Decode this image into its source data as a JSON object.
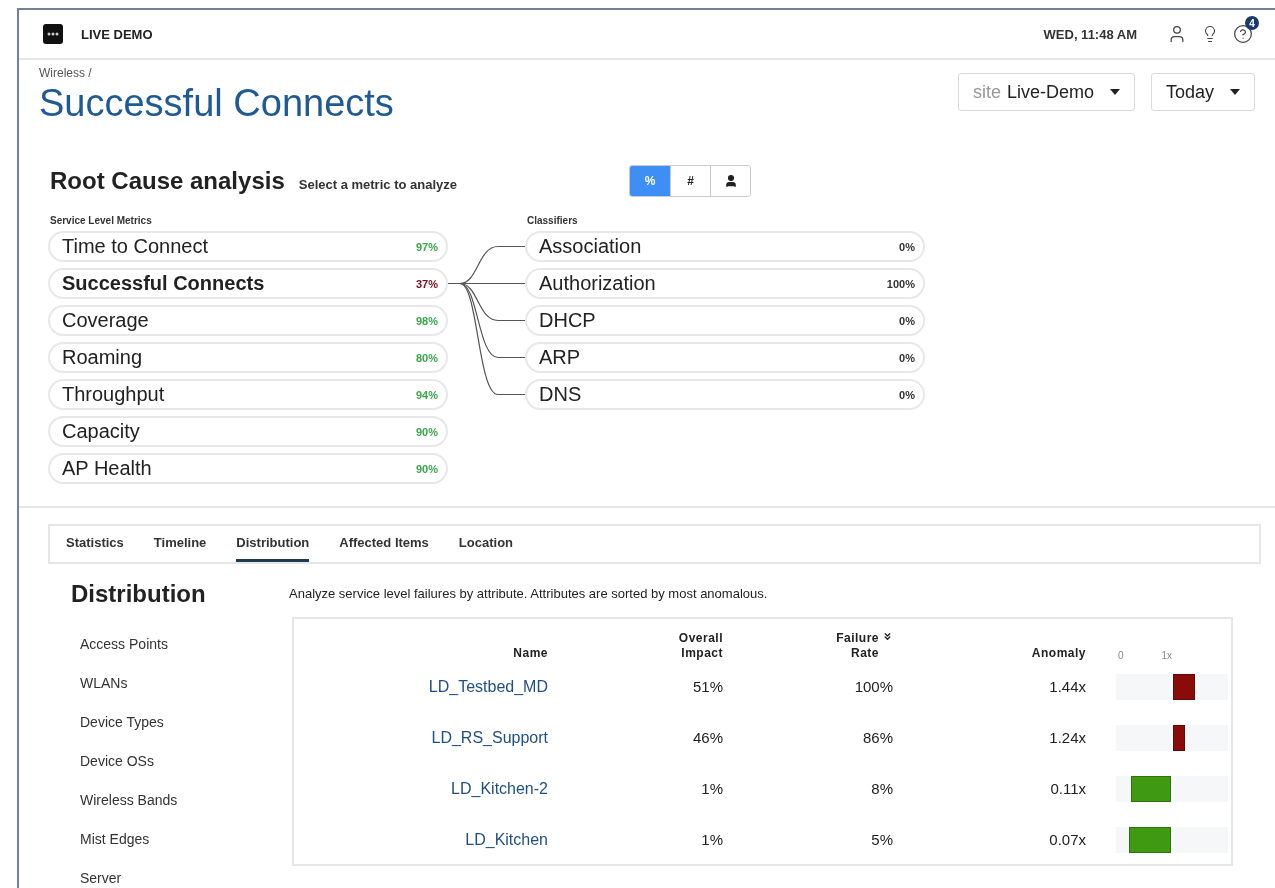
{
  "topbar": {
    "org": "LIVE DEMO",
    "clock": "WED, 11:48 AM",
    "help_badge": "4"
  },
  "breadcrumb": "Wireless /",
  "title": "Successful Connects",
  "filters": [
    {
      "prefix": "site",
      "value": "Live-Demo"
    },
    {
      "value": "Today"
    }
  ],
  "root_cause": {
    "title": "Root Cause analysis",
    "hint": "Select a metric to analyze",
    "toggle": [
      {
        "kind": "text",
        "label": "%",
        "selected": true
      },
      {
        "kind": "text",
        "label": "#",
        "selected": false
      },
      {
        "kind": "icon",
        "selected": false
      }
    ],
    "metrics_label": "Service Level Metrics",
    "metrics": [
      {
        "name": "Time to Connect",
        "value": "97%",
        "color": "#3aa64a",
        "selected": false
      },
      {
        "name": "Successful Connects",
        "value": "37%",
        "color": "#7a0c1c",
        "selected": true
      },
      {
        "name": "Coverage",
        "value": "98%",
        "color": "#3aa64a",
        "selected": false
      },
      {
        "name": "Roaming",
        "value": "80%",
        "color": "#3aa64a",
        "selected": false
      },
      {
        "name": "Throughput",
        "value": "94%",
        "color": "#3aa64a",
        "selected": false
      },
      {
        "name": "Capacity",
        "value": "90%",
        "color": "#3aa64a",
        "selected": false
      },
      {
        "name": "AP Health",
        "value": "90%",
        "color": "#3aa64a",
        "selected": false
      }
    ],
    "classifiers_label": "Classifiers",
    "classifiers": [
      {
        "name": "Association",
        "value": "0%"
      },
      {
        "name": "Authorization",
        "value": "100%"
      },
      {
        "name": "DHCP",
        "value": "0%"
      },
      {
        "name": "ARP",
        "value": "0%"
      },
      {
        "name": "DNS",
        "value": "0%"
      }
    ]
  },
  "tabs": [
    {
      "label": "Statistics",
      "selected": false
    },
    {
      "label": "Timeline",
      "selected": false
    },
    {
      "label": "Distribution",
      "selected": true
    },
    {
      "label": "Affected Items",
      "selected": false
    },
    {
      "label": "Location",
      "selected": false
    }
  ],
  "distribution": {
    "title": "Distribution",
    "description": "Analyze service level failures by attribute. Attributes are sorted by most anomalous.",
    "attributes": [
      "Access Points",
      "WLANs",
      "Device Types",
      "Device OSs",
      "Wireless Bands",
      "Mist Edges",
      "Server"
    ],
    "columns": [
      "Name",
      "Overall Impact",
      "Failure Rate",
      "Anomaly"
    ],
    "scale": [
      "0",
      "1x"
    ],
    "rows": [
      {
        "name": "LD_Testbed_MD",
        "impact": "51%",
        "failure_rate": "100%",
        "anomaly": "1.44x",
        "bar": {
          "kind": "over",
          "color": "#8b0a0a",
          "level": 0.4
        }
      },
      {
        "name": "LD_RS_Support",
        "impact": "46%",
        "failure_rate": "86%",
        "anomaly": "1.24x",
        "bar": {
          "kind": "over",
          "color": "#8b0a0a",
          "level": 0.22
        }
      },
      {
        "name": "LD_Kitchen-2",
        "impact": "1%",
        "failure_rate": "8%",
        "anomaly": "0.11x",
        "bar": {
          "kind": "under",
          "color": "#3f9a12",
          "level": 0.73
        }
      },
      {
        "name": "LD_Kitchen",
        "impact": "1%",
        "failure_rate": "5%",
        "anomaly": "0.07x",
        "bar": {
          "kind": "under",
          "color": "#3f9a12",
          "level": 0.76
        }
      }
    ]
  }
}
